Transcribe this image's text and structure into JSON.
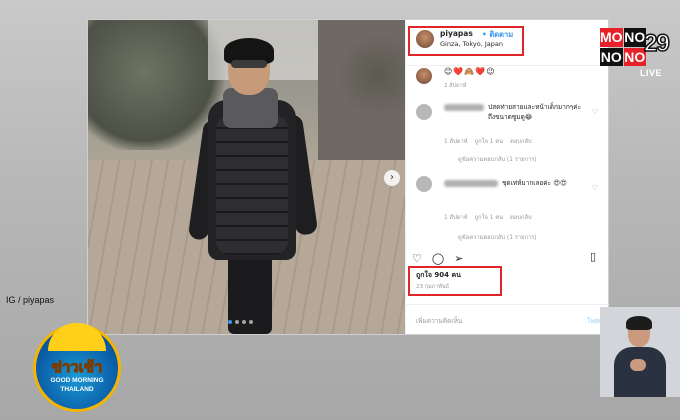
{
  "post": {
    "username": "piyapas",
    "follow_label": "• ติดตาม",
    "location": "Ginza, Tokyo, Japan",
    "caption_emojis": "😉❤️🙈❤️😉",
    "caption_time": "2 สัปดาห์",
    "comments": [
      {
        "text": "ปสดท่ายสายและหน้าเด็กมากๆค่ะ ถึงขนาดซูมดู😂",
        "time": "1 สัปดาห์",
        "likes": "ถูกใจ 1 คน",
        "reply": "ตอบกลับ",
        "view_replies": "ดูข้อความตอบกลับ (1 รายการ)"
      },
      {
        "text": "ชุดเท่ห์มากเลยค่ะ 😍😍",
        "time": "1 สัปดาห์",
        "likes": "ถูกใจ 1 คน",
        "reply": "ตอบกลับ",
        "view_replies": "ดูข้อความตอบกลับ (1 รายการ)"
      }
    ],
    "likes_count": "ถูกใจ 904 คน",
    "date": "23 กุมภาพันธ์",
    "add_comment_placeholder": "เพิ่มความคิดเห็น",
    "post_button": "โพสต์"
  },
  "broadcast": {
    "channel_logo_letters": [
      "MO",
      "NO",
      "NO",
      "29"
    ],
    "live_label": "LIVE",
    "credit": "IG / piyapas",
    "program_title": "ข่าวเช้า",
    "program_subtitle_1": "GOOD MORNING",
    "program_subtitle_2": "THAILAND"
  },
  "colors": {
    "highlight": "#e0242b",
    "instagram_blue": "#3897f0",
    "channel_red": "#e8202a"
  },
  "icons": [
    "heart-icon",
    "comment-icon",
    "share-icon",
    "bookmark-icon",
    "next-arrow-icon"
  ]
}
